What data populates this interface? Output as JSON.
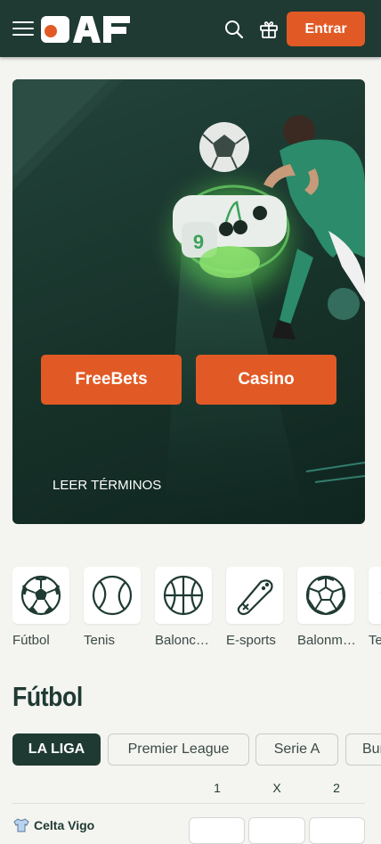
{
  "header": {
    "logo_text": "PAF",
    "login_label": "Entrar",
    "colors": {
      "bg": "#1f3a33",
      "accent": "#e15a25"
    },
    "icons": [
      "menu-icon",
      "search-icon",
      "gift-icon"
    ]
  },
  "hero": {
    "buttons": [
      "FreeBets",
      "Casino"
    ],
    "terms_label": "LEER TÉRMINOS"
  },
  "sports": [
    {
      "label": "Fútbol",
      "icon": "soccer-ball-icon"
    },
    {
      "label": "Tenis",
      "icon": "tennis-ball-icon"
    },
    {
      "label": "Baloncesto",
      "icon": "basketball-icon"
    },
    {
      "label": "E-sports",
      "icon": "gamepad-icon"
    },
    {
      "label": "Balonmano",
      "icon": "handball-icon"
    },
    {
      "label": "Tenis de mesa",
      "icon": "table-tennis-icon"
    }
  ],
  "section": {
    "title": "Fútbol",
    "leagues": [
      "LA LIGA",
      "Premier League",
      "Serie A",
      "Bundesliga"
    ],
    "odds_headers": [
      "1",
      "X",
      "2"
    ],
    "match": {
      "home_team": "Celta Vigo"
    }
  }
}
